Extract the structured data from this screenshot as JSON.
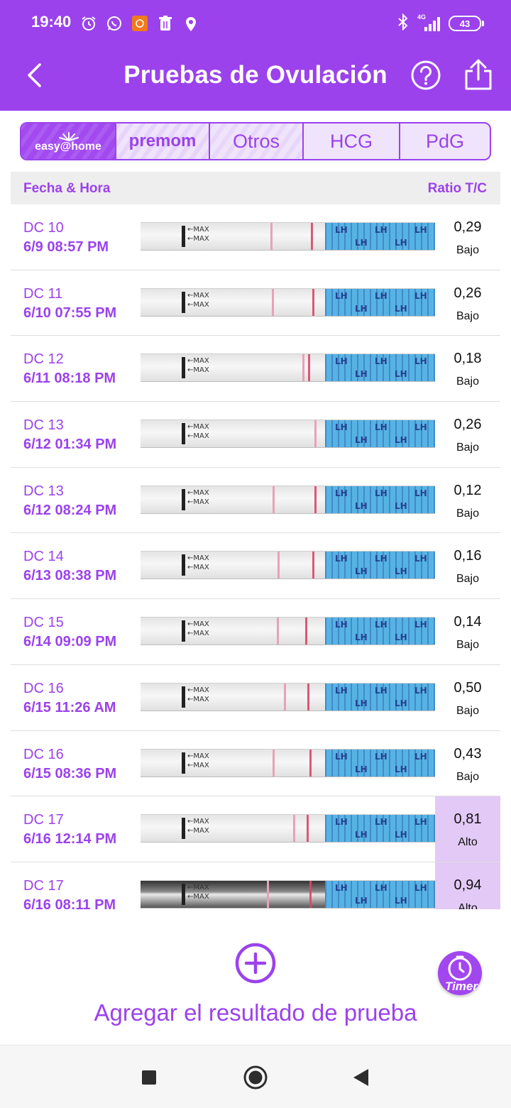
{
  "status_bar": {
    "time": "19:40",
    "battery": "43",
    "network": "4G"
  },
  "header": {
    "title": "Pruebas de Ovulación"
  },
  "tabs": [
    {
      "label": "easy@home"
    },
    {
      "label": "premom"
    },
    {
      "label": "Otros"
    },
    {
      "label": "HCG"
    },
    {
      "label": "PdG"
    }
  ],
  "table": {
    "col_left": "Fecha & Hora",
    "col_right": "Ratio T/C",
    "rows": [
      {
        "dc": "DC 10",
        "datetime": "6/9  08:57 PM",
        "ratio": "0,29",
        "level": "Bajo",
        "high": false
      },
      {
        "dc": "DC 11",
        "datetime": "6/10  07:55 PM",
        "ratio": "0,26",
        "level": "Bajo",
        "high": false
      },
      {
        "dc": "DC 12",
        "datetime": "6/11  08:18 PM",
        "ratio": "0,18",
        "level": "Bajo",
        "high": false
      },
      {
        "dc": "DC 13",
        "datetime": "6/12  01:34 PM",
        "ratio": "0,26",
        "level": "Bajo",
        "high": false
      },
      {
        "dc": "DC 13",
        "datetime": "6/12  08:24 PM",
        "ratio": "0,12",
        "level": "Bajo",
        "high": false
      },
      {
        "dc": "DC 14",
        "datetime": "6/13  08:38 PM",
        "ratio": "0,16",
        "level": "Bajo",
        "high": false
      },
      {
        "dc": "DC 15",
        "datetime": "6/14  09:09 PM",
        "ratio": "0,14",
        "level": "Bajo",
        "high": false
      },
      {
        "dc": "DC 16",
        "datetime": "6/15  11:26 AM",
        "ratio": "0,50",
        "level": "Bajo",
        "high": false
      },
      {
        "dc": "DC 16",
        "datetime": "6/15  08:36 PM",
        "ratio": "0,43",
        "level": "Bajo",
        "high": false
      },
      {
        "dc": "DC 17",
        "datetime": "6/16  12:14 PM",
        "ratio": "0,81",
        "level": "Alto",
        "high": true
      },
      {
        "dc": "DC 17",
        "datetime": "6/16  08:11 PM",
        "ratio": "0,94",
        "level": "Alto",
        "high": true
      }
    ]
  },
  "strip_text": {
    "max": "MAX",
    "lh": "LH"
  },
  "actions": {
    "add_label": "Agregar el resultado de prueba",
    "timer_label": "Timer"
  },
  "colors": {
    "accent": "#9b42ec",
    "highlight": "#e3c9f6"
  }
}
